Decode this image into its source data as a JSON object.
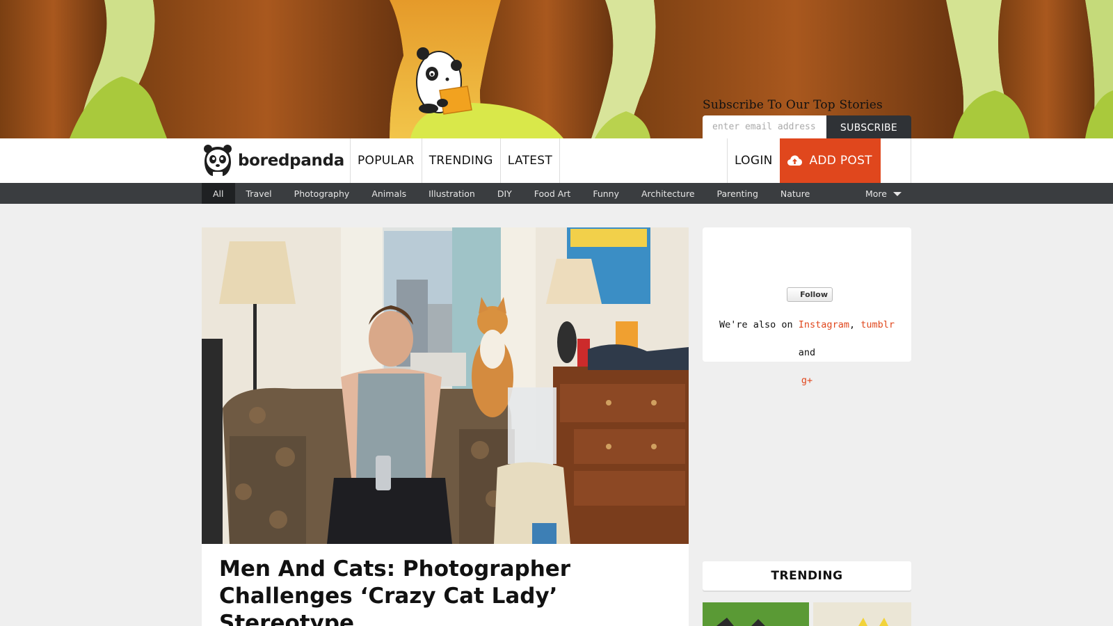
{
  "banner": {
    "subscribe_title": "Subscribe To Our Top Stories",
    "email_placeholder": "enter email address",
    "subscribe_label": "SUBSCRIBE"
  },
  "header": {
    "logo_text": "boredpanda",
    "nav": [
      "POPULAR",
      "TRENDING",
      "LATEST"
    ],
    "login_label": "LOGIN",
    "add_post_label": "ADD POST"
  },
  "categories": {
    "items": [
      "All",
      "Travel",
      "Photography",
      "Animals",
      "Illustration",
      "DIY",
      "Food Art",
      "Funny",
      "Architecture",
      "Parenting",
      "Nature"
    ],
    "active": "All",
    "more_label": "More"
  },
  "article": {
    "title": "Men And Cats: Photographer Challenges ‘Crazy Cat Lady’ Stereotype"
  },
  "sidebar": {
    "follow_label": "Follow",
    "also_on_prefix": "We're also on",
    "instagram": "Instagram",
    "comma": ",",
    "tumblr": "tumblr",
    "and": "and",
    "gplus": "g+",
    "trending_label": "TRENDING"
  },
  "colors": {
    "accent": "#e0471d",
    "catbar": "#3a3d40",
    "subscribe_button": "#2f3236"
  }
}
